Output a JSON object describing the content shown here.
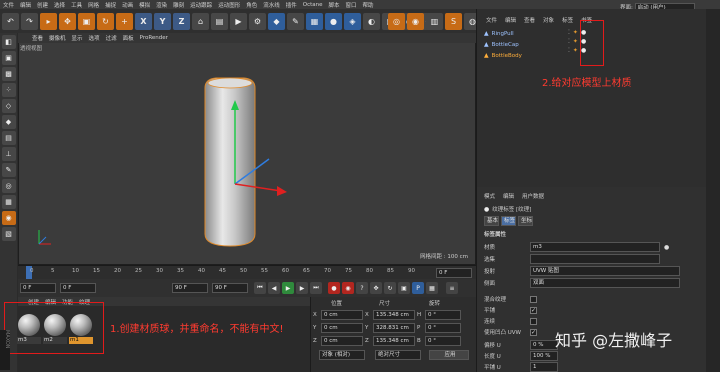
{
  "menubar": {
    "items": [
      "文件",
      "编辑",
      "创建",
      "选择",
      "工具",
      "网格",
      "捕捉",
      "动画",
      "模拟",
      "渲染",
      "雕刻",
      "运动跟踪",
      "运动图形",
      "角色",
      "流水线",
      "插件",
      "Octane",
      "脚本",
      "窗口",
      "帮助"
    ],
    "layout_label": "界面:",
    "layout_value": "启动 (用户)"
  },
  "toolbar": {
    "icons": [
      "undo-icon",
      "redo-icon",
      "select-icon",
      "move-icon",
      "scale-icon",
      "rotate-icon",
      "move-icon",
      "x-axis-icon",
      "y-axis-icon",
      "z-axis-icon",
      "coordinate-icon",
      "film-icon",
      "render-icon",
      "render-settings-icon",
      "cube-icon",
      "pen-icon",
      "subdivide-icon",
      "sphere-icon",
      "cloner-icon",
      "deformer-icon",
      "scene-icon",
      "camera-icon",
      "light-icon"
    ],
    "xyz": [
      "X",
      "Y",
      "Z"
    ]
  },
  "viewport": {
    "menu": [
      "查看",
      "摄像机",
      "显示",
      "选项",
      "过滤",
      "面板",
      "ProRender"
    ],
    "title": "透视视图",
    "grid_info": "网格间距 : 100 cm"
  },
  "timeline": {
    "ticks": [
      "0",
      "5",
      "10",
      "15",
      "20",
      "25",
      "30",
      "35",
      "40",
      "45",
      "50",
      "55",
      "60",
      "65",
      "70",
      "75",
      "80",
      "85",
      "90"
    ],
    "end_frame": "0 F"
  },
  "playback": {
    "start": "0 F",
    "current": "0 F",
    "end": "90 F",
    "max": "90 F"
  },
  "material_manager": {
    "menu": [
      "创建",
      "编辑",
      "功能",
      "纹理"
    ],
    "materials": [
      {
        "name": "m3",
        "selected": false
      },
      {
        "name": "m2",
        "selected": false
      },
      {
        "name": "m1",
        "selected": true
      }
    ],
    "annotation": "1.创建材质球，并重命名，不能有中文!"
  },
  "coordinates": {
    "headers": [
      "位置",
      "尺寸",
      "旋转"
    ],
    "rows": [
      {
        "axis": "X",
        "pos": "0 cm",
        "size": "135.348 cm",
        "rot_label": "H",
        "rot": "0 °"
      },
      {
        "axis": "Y",
        "pos": "0 cm",
        "size": "328.831 cm",
        "rot_label": "P",
        "rot": "0 °"
      },
      {
        "axis": "Z",
        "pos": "0 cm",
        "size": "135.348 cm",
        "rot_label": "B",
        "rot": "0 °"
      }
    ],
    "mode": "对象 (相对)",
    "size_mode": "绝对尺寸",
    "apply": "应用"
  },
  "object_manager": {
    "menu": [
      "文件",
      "编辑",
      "查看",
      "对象",
      "标签",
      "书签"
    ],
    "objects": [
      {
        "name": "RingPull",
        "selected": false
      },
      {
        "name": "BottleCap",
        "selected": false
      },
      {
        "name": "BottleBody",
        "selected": true
      }
    ],
    "annotation": "2.给对应模型上材质"
  },
  "attributes": {
    "menu": [
      "模式",
      "编辑",
      "用户数据"
    ],
    "title": "纹理标签 [纹理]",
    "tabs": [
      "基本",
      "标签",
      "坐标"
    ],
    "section": "标签属性",
    "rows": [
      {
        "label": "材质",
        "value": "m3"
      },
      {
        "label": "选集",
        "value": ""
      },
      {
        "label": "投射",
        "value": "UVW 贴图"
      },
      {
        "label": "侧面",
        "value": "双面"
      }
    ],
    "checks": [
      {
        "label": "混合纹理",
        "checked": false
      },
      {
        "label": "平铺",
        "checked": true
      },
      {
        "label": "连续",
        "checked": false
      },
      {
        "label": "使用凹凸 UVW",
        "checked": true
      }
    ],
    "offset": [
      {
        "label": "偏移 U",
        "value": "0 %"
      },
      {
        "label": "长度 U",
        "value": "100 %"
      },
      {
        "label": "平铺 U",
        "value": "1"
      }
    ]
  },
  "watermark": "知乎 @左撒峰子",
  "colors": {
    "accent": "#e0962e",
    "annotation": "#ff3b30"
  }
}
